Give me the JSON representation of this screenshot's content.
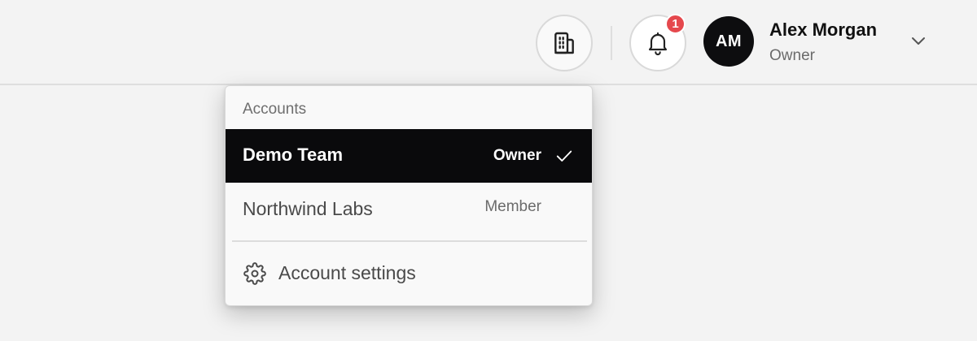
{
  "header": {
    "user": {
      "initials": "AM",
      "name": "Alex Morgan",
      "role": "Owner"
    },
    "notifications": {
      "count": "1"
    },
    "icons": {
      "organization": "building-icon",
      "notifications": "bell-icon",
      "menu": "chevron-down-icon"
    }
  },
  "dropdown": {
    "header": "Accounts",
    "accounts": [
      {
        "name": "Demo Team",
        "role": "Owner",
        "selected": true
      },
      {
        "name": "Northwind Labs",
        "role": "Member",
        "selected": false
      }
    ],
    "settings_label": "Account settings",
    "icons": {
      "selected": "checkmark-icon",
      "settings": "gear-icon"
    }
  },
  "colors": {
    "selected_row_bg": "#0a0a0c",
    "badge": "#e5484d",
    "avatar_bg": "#0d0d0f"
  }
}
